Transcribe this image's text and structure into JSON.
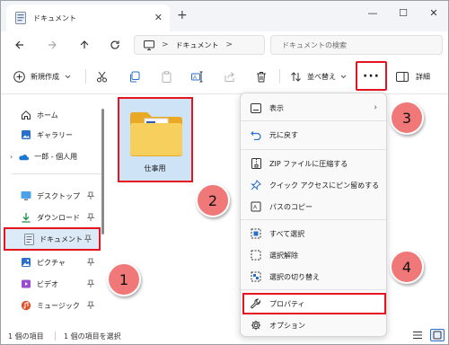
{
  "window": {
    "tab_title": "ドキュメント",
    "new_tab": "+",
    "close": "✕",
    "minimize": "—",
    "maximize": "☐",
    "win_close": "✕"
  },
  "address": {
    "path_sep1": ">",
    "path_crumb": "ドキュメント",
    "path_sep2": ">",
    "search_placeholder": "ドキュメントの検索"
  },
  "toolbar": {
    "new_label": "新規作成",
    "sort_label": "並べ替え",
    "more_label": "···",
    "details_label": "詳細"
  },
  "sidebar": {
    "items": [
      {
        "label": "ホーム"
      },
      {
        "label": "ギャラリー"
      },
      {
        "label": "一郎 - 個人用"
      },
      {
        "label": "デスクトップ"
      },
      {
        "label": "ダウンロード"
      },
      {
        "label": "ドキュメント"
      },
      {
        "label": "ピクチャ"
      },
      {
        "label": "ビデオ"
      },
      {
        "label": "ミュージック"
      }
    ]
  },
  "content": {
    "folder_name": "仕事用"
  },
  "menu": {
    "items": [
      {
        "label": "表示"
      },
      {
        "label": "元に戻す"
      },
      {
        "label": "ZIP ファイルに圧縮する"
      },
      {
        "label": "クイック アクセスにピン留めする"
      },
      {
        "label": "パスのコピー"
      },
      {
        "label": "すべて選択"
      },
      {
        "label": "選択解除"
      },
      {
        "label": "選択の切り替え"
      },
      {
        "label": "プロパティ"
      },
      {
        "label": "オプション"
      }
    ]
  },
  "status": {
    "count": "1 個の項目",
    "selected": "1 個の項目を選択"
  },
  "badges": [
    "1",
    "2",
    "3",
    "4"
  ],
  "colors": {
    "highlight": "#e5141f",
    "badge": "#f07878",
    "selection": "#dce9f7",
    "folder": "#f5c84c"
  }
}
